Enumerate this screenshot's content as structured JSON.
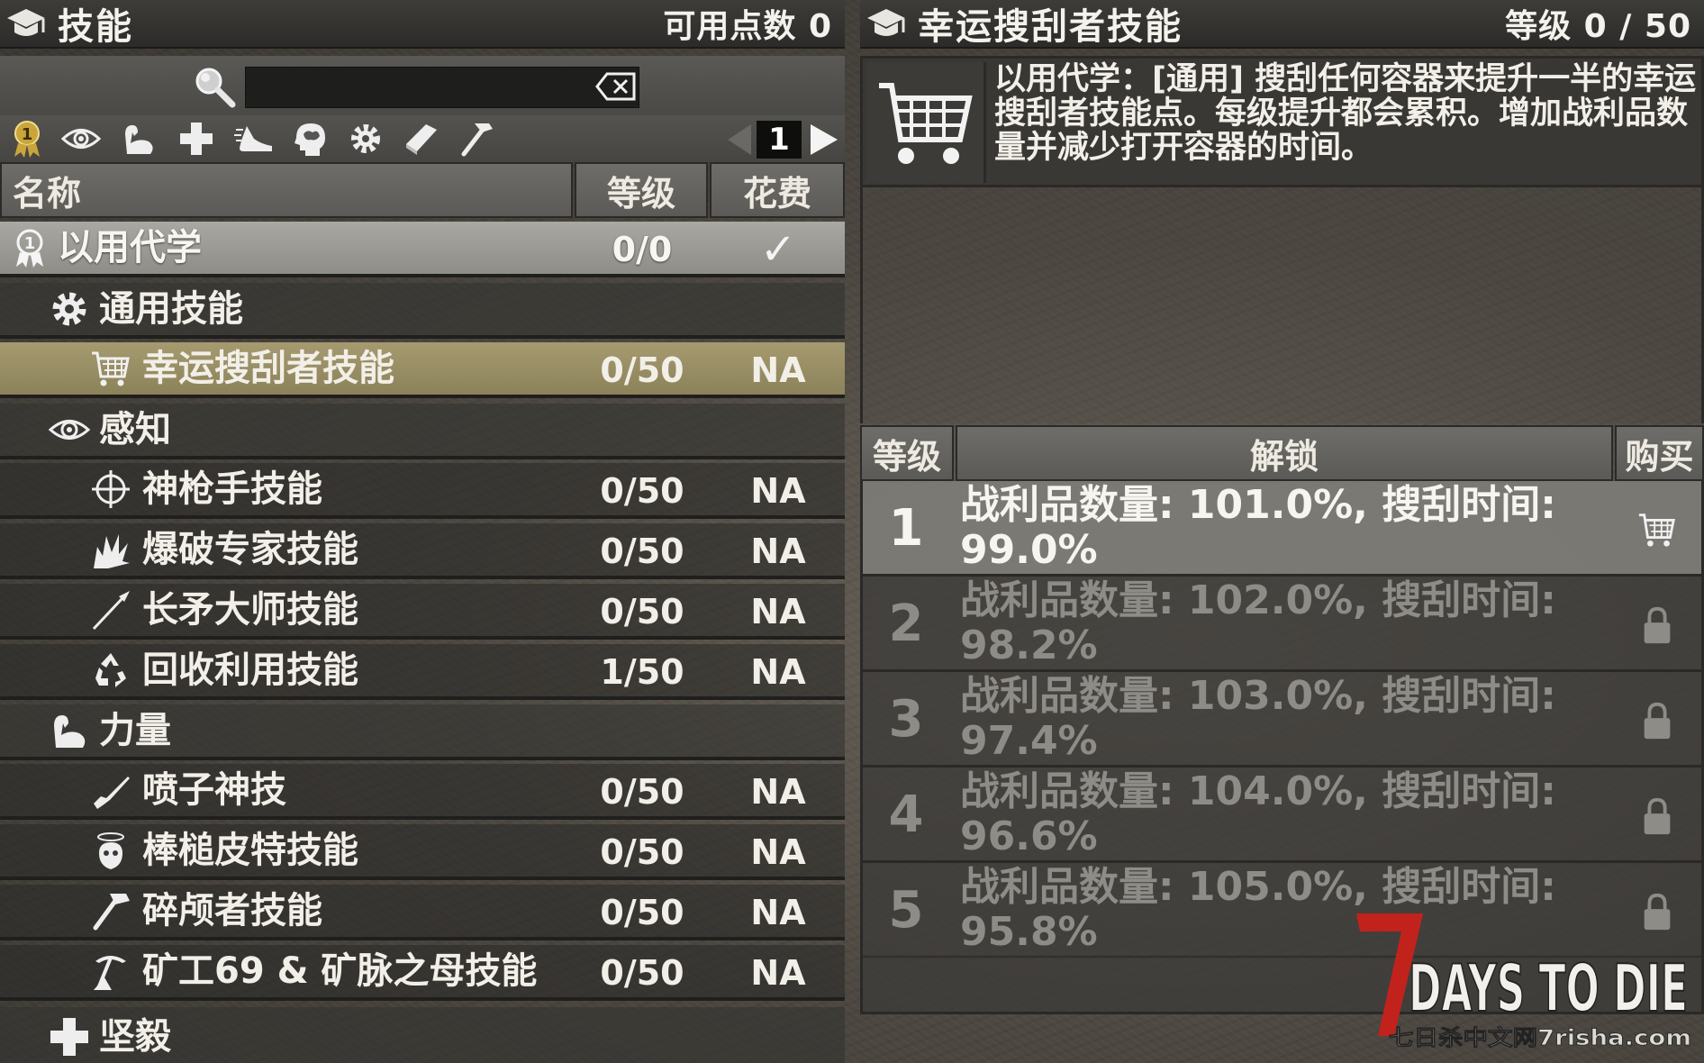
{
  "left_panel": {
    "title": "技能",
    "points_text": "可用点数 0",
    "search": {
      "value": "",
      "placeholder": ""
    },
    "categories": [
      "attributes-icon",
      "perception-icon",
      "strength-icon",
      "fortitude-icon",
      "agility-icon",
      "intellect-icon",
      "general-icon",
      "books-icon",
      "crafting-icon"
    ],
    "page_number": "1",
    "columns": {
      "name": "名称",
      "level": "等级",
      "cost": "花费"
    },
    "rows": [
      {
        "kind": "attr",
        "icon": "badge-icon",
        "label": "以用代学",
        "level": "0/0",
        "cost": "✓"
      },
      {
        "kind": "cat",
        "icon": "gear-icon",
        "label": "通用技能",
        "level": "",
        "cost": ""
      },
      {
        "kind": "skill",
        "icon": "cart-icon",
        "label": "幸运搜刮者技能",
        "level": "0/50",
        "cost": "NA",
        "selected": true
      },
      {
        "kind": "cat",
        "icon": "eye-icon",
        "label": "感知",
        "level": "",
        "cost": ""
      },
      {
        "kind": "skill",
        "icon": "crosshair-icon",
        "label": "神枪手技能",
        "level": "0/50",
        "cost": "NA"
      },
      {
        "kind": "skill",
        "icon": "explosion-icon",
        "label": "爆破专家技能",
        "level": "0/50",
        "cost": "NA"
      },
      {
        "kind": "skill",
        "icon": "spear-icon",
        "label": "长矛大师技能",
        "level": "0/50",
        "cost": "NA"
      },
      {
        "kind": "skill",
        "icon": "recycle-icon",
        "label": "回收利用技能",
        "level": "1/50",
        "cost": "NA"
      },
      {
        "kind": "cat",
        "icon": "muscle-icon",
        "label": "力量",
        "level": "",
        "cost": ""
      },
      {
        "kind": "skill",
        "icon": "shotgun-icon",
        "label": "喷子神技",
        "level": "0/50",
        "cost": "NA"
      },
      {
        "kind": "skill",
        "icon": "dizzy-icon",
        "label": "棒槌皮特技能",
        "level": "0/50",
        "cost": "NA"
      },
      {
        "kind": "skill",
        "icon": "sledgehammer-icon",
        "label": "碎颅者技能",
        "level": "0/50",
        "cost": "NA"
      },
      {
        "kind": "skill",
        "icon": "pickaxe-icon",
        "label": "矿工69 & 矿脉之母技能",
        "level": "0/50",
        "cost": "NA"
      },
      {
        "kind": "cat",
        "icon": "plus-icon",
        "label": "坚毅",
        "level": "",
        "cost": ""
      }
    ]
  },
  "right_panel": {
    "title": "幸运搜刮者技能",
    "level_text": "等级 0 / 50",
    "description": "以用代学：[通用] 搜刮任何容器来提升一半的幸运搜刮者技能点。每级提升都会累积。增加战利品数量并减少打开容器的时间。",
    "columns": {
      "level": "等级",
      "unlock": "解锁",
      "buy": "购买"
    },
    "levels": [
      {
        "num": "1",
        "text": "战利品数量: 101.0%, 搜刮时间: 99.0%",
        "active": true,
        "action_icon": "cart-icon"
      },
      {
        "num": "2",
        "text": "战利品数量: 102.0%, 搜刮时间: 98.2%",
        "active": false,
        "action_icon": "lock-icon"
      },
      {
        "num": "3",
        "text": "战利品数量: 103.0%, 搜刮时间: 97.4%",
        "active": false,
        "action_icon": "lock-icon"
      },
      {
        "num": "4",
        "text": "战利品数量: 104.0%, 搜刮时间: 96.6%",
        "active": false,
        "action_icon": "lock-icon"
      },
      {
        "num": "5",
        "text": "战利品数量: 105.0%, 搜刮时间: 95.8%",
        "active": false,
        "action_icon": "lock-icon"
      }
    ]
  },
  "watermark": {
    "logo_text": "7DAYS TO DIE",
    "site_text": "七日杀中文网7risha.com"
  },
  "colors": {
    "selected_row": "#a59a70",
    "attr_row": "#a9a8a3",
    "logo_red": "#c2221c"
  }
}
